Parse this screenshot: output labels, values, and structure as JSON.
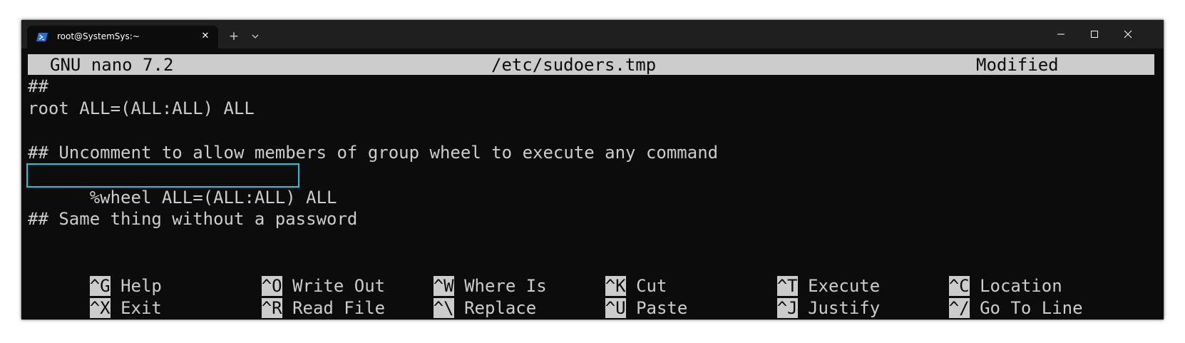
{
  "tab": {
    "title": "root@SystemSys:~",
    "close_glyph": "✕",
    "new_tab_glyph": "+",
    "icon": "powershell-icon"
  },
  "window_controls": [
    "minimize-icon",
    "maximize-icon",
    "close-icon"
  ],
  "nano": {
    "version": "GNU nano 7.2",
    "filename": "/etc/sudoers.tmp",
    "state": "Modified"
  },
  "lines": [
    "##",
    "root ALL=(ALL:ALL) ALL",
    "",
    "## Uncomment to allow members of group wheel to execute any command",
    "%wheel ALL=(ALL:ALL) ALL",
    "",
    "## Same thing without a password"
  ],
  "shortcuts": [
    [
      {
        "key": "^G",
        "label": "Help"
      },
      {
        "key": "^O",
        "label": "Write Out"
      },
      {
        "key": "^W",
        "label": "Where Is"
      },
      {
        "key": "^K",
        "label": "Cut"
      },
      {
        "key": "^T",
        "label": "Execute"
      },
      {
        "key": "^C",
        "label": "Location"
      }
    ],
    [
      {
        "key": "^X",
        "label": "Exit"
      },
      {
        "key": "^R",
        "label": "Read File"
      },
      {
        "key": "^\\",
        "label": "Replace"
      },
      {
        "key": "^U",
        "label": "Paste"
      },
      {
        "key": "^J",
        "label": "Justify"
      },
      {
        "key": "^/",
        "label": "Go To Line"
      }
    ]
  ],
  "colors": {
    "terminal_bg": "#0c0c0c",
    "terminal_fg": "#cccccc",
    "highlight": "#1fc4d6",
    "titlebar": "#1f1f1f"
  }
}
